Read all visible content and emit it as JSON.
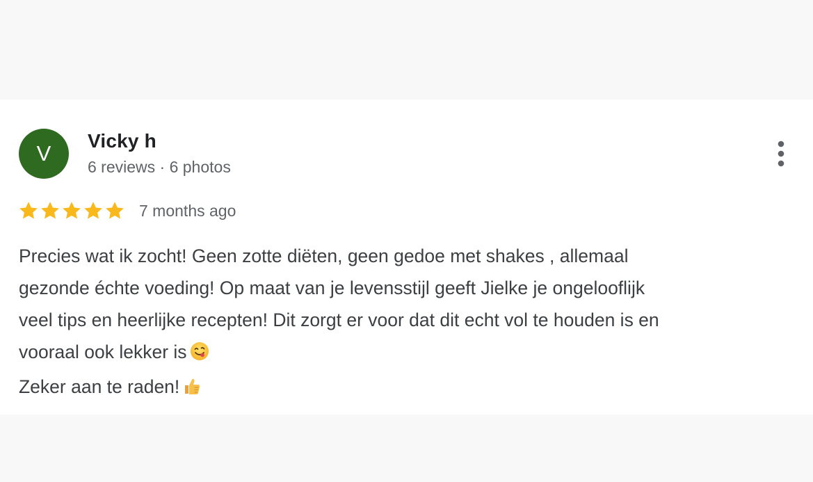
{
  "review": {
    "avatar_letter": "V",
    "avatar_color": "#2e6a1f",
    "author_name": "Vicky h",
    "author_meta": "6 reviews · 6 photos",
    "rating": 5,
    "rating_max": 5,
    "star_color": "#f9b81b",
    "time_ago": "7 months ago",
    "lines": [
      "Precies wat ik zocht! Geen zotte diëten, geen gedoe met shakes , allemaal",
      "gezonde échte voeding! Op maat van je levensstijl geeft Jielke je ongelooflijk",
      "veel tips en heerlijke recepten! Dit zorgt er voor dat dit echt vol te houden is en",
      "vooraal ook lekker is",
      "Zeker aan te raden!"
    ],
    "emojis": {
      "line4": "face-savoring-food-emoji",
      "line5": "thumbs-up-emoji"
    },
    "more_icon": "more-vert-icon"
  }
}
